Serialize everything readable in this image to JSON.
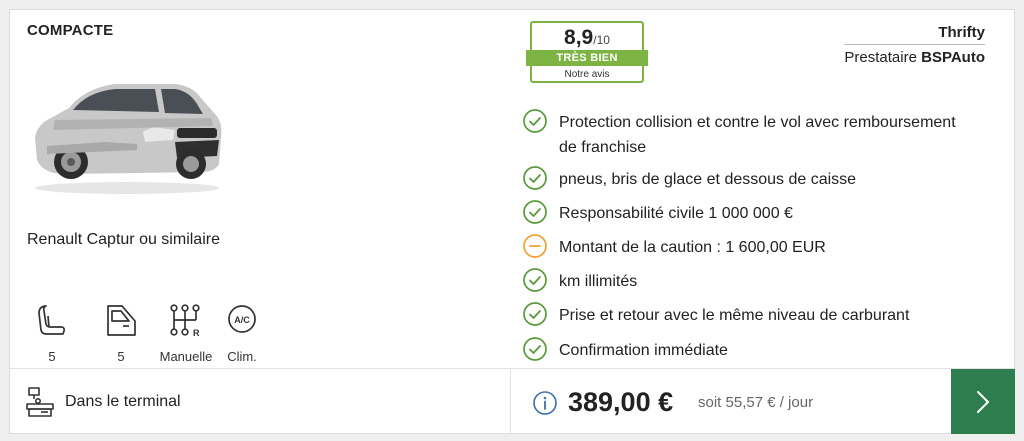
{
  "card": {
    "category": "COMPACTE",
    "car_name": "Renault Captur ou similaire",
    "car_image_icon": "car-photo"
  },
  "features": [
    {
      "icon": "seat-icon",
      "label": "5"
    },
    {
      "icon": "door-icon",
      "label": "5"
    },
    {
      "icon": "gearbox-icon",
      "label": "Manuelle"
    },
    {
      "icon": "ac-icon",
      "label": "Clim."
    }
  ],
  "rating": {
    "score": "8,9",
    "scale": "/10",
    "label": "TRÈS BIEN",
    "sublabel": "Notre avis",
    "color": "#7cb342"
  },
  "supplier": {
    "name": "Thrifty",
    "provider_prefix": "Prestataire",
    "provider_name": "BSPAuto"
  },
  "inclusions": [
    {
      "status": "included",
      "text_line1": "Protection collision et contre le vol avec remboursement",
      "text_line2": "de franchise"
    },
    {
      "status": "included",
      "text_line1": "pneus, bris de glace et dessous de caisse"
    },
    {
      "status": "included",
      "text_line1": "Responsabilité civile 1 000 000 €"
    },
    {
      "status": "warning",
      "text_line1": "Montant de la caution : 1 600,00 EUR"
    },
    {
      "status": "included",
      "text_line1": "km illimités"
    },
    {
      "status": "included",
      "text_line1": "Prise et retour avec le même niveau de carburant"
    },
    {
      "status": "included",
      "text_line1": "Confirmation immédiate"
    }
  ],
  "pickup": {
    "icon": "terminal-desk-icon",
    "label": "Dans le terminal"
  },
  "price": {
    "total": "389,00 €",
    "per_day": "soit 55,57 € / jour",
    "info_icon": "info-icon"
  },
  "colors": {
    "check_green": "#5a9a3b",
    "warning_orange": "#f0a030",
    "button_green": "#2e7d4f",
    "info_blue": "#3d6fa8"
  },
  "next_button": {
    "icon": "chevron-right-icon"
  }
}
